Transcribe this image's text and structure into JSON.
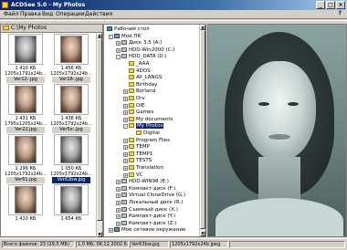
{
  "window": {
    "title": "ACDSee 5.0 - My Photos",
    "minimize": "_",
    "maximize": "□",
    "close": "×"
  },
  "menu": {
    "items": [
      "Файл",
      "Правка",
      "Вид",
      "Операции",
      "Действия"
    ],
    "help": "?"
  },
  "browser": {
    "path": "C:\\My Photos",
    "thumbnails": [
      {
        "size": "1 410 КБ",
        "dims": "1205x1792x24b...",
        "name": "Ver12-.jpg",
        "tone": "bw",
        "selected": false
      },
      {
        "size": "1 456 КБ",
        "dims": "1205x1792x24b...",
        "name": "Ver18-.jpg",
        "tone": "color",
        "selected": false
      },
      {
        "size": "1 431 КБ",
        "dims": "1795x1205x24b...",
        "name": "Ver22.jpg",
        "tone": "color",
        "selected": false
      },
      {
        "size": "1 438 КБ",
        "dims": "1205x1792x24b...",
        "name": "Ver5x-.jpg",
        "tone": "color",
        "selected": false
      },
      {
        "size": "1 299 КБ",
        "dims": "1205x1792x24b...",
        "name": "Ver61.jpg",
        "tone": "color",
        "selected": false
      },
      {
        "size": "1 050 КБ",
        "dims": "1205x1792x24b...",
        "name": "Ver63bw.jpg",
        "tone": "bw",
        "selected": true
      },
      {
        "size": "1 410 КБ",
        "dims": "",
        "name": "",
        "tone": "color",
        "selected": false
      },
      {
        "size": "1 654 КБ",
        "dims": "",
        "name": "",
        "tone": "bw",
        "selected": false
      }
    ]
  },
  "tree": {
    "items": [
      {
        "label": "Рабочий стол",
        "icon": "desktop-icon",
        "level": 0,
        "expander": "",
        "selected": false
      },
      {
        "label": "Мой ПК",
        "icon": "computer-icon",
        "level": 1,
        "expander": "-",
        "selected": false
      },
      {
        "label": "Диск 3,5 (A:)",
        "icon": "floppy-icon",
        "level": 2,
        "expander": "+",
        "selected": false
      },
      {
        "label": "HDD-Win2000 (C:)",
        "icon": "drive-icon",
        "level": 2,
        "expander": "+",
        "selected": false
      },
      {
        "label": "HDD_DATA (D:)",
        "icon": "drive-icon",
        "level": 2,
        "expander": "-",
        "selected": false
      },
      {
        "label": "_AAA",
        "icon": "folder-icon",
        "level": 3,
        "expander": "",
        "selected": false
      },
      {
        "label": "4DOS",
        "icon": "folder-icon",
        "level": 3,
        "expander": "",
        "selected": false
      },
      {
        "label": "All_LANGS",
        "icon": "folder-icon",
        "level": 3,
        "expander": "",
        "selected": false
      },
      {
        "label": "Birthday",
        "icon": "folder-icon",
        "level": 3,
        "expander": "",
        "selected": false
      },
      {
        "label": "Borland",
        "icon": "folder-icon",
        "level": 3,
        "expander": "+",
        "selected": false
      },
      {
        "label": "Drv",
        "icon": "folder-icon",
        "level": 3,
        "expander": "+",
        "selected": false
      },
      {
        "label": "DIE",
        "icon": "folder-icon",
        "level": 3,
        "expander": "+",
        "selected": false
      },
      {
        "label": "Games",
        "icon": "folder-icon",
        "level": 3,
        "expander": "+",
        "selected": false
      },
      {
        "label": "My documents",
        "icon": "folder-icon",
        "level": 3,
        "expander": "+",
        "selected": false
      },
      {
        "label": "My Photos",
        "icon": "folder-icon",
        "level": 3,
        "expander": "-",
        "selected": true
      },
      {
        "label": "Digital",
        "icon": "folder-icon",
        "level": 4,
        "expander": "",
        "selected": false
      },
      {
        "label": "Program Files",
        "icon": "folder-icon",
        "level": 3,
        "expander": "+",
        "selected": false
      },
      {
        "label": "TEMP",
        "icon": "folder-icon",
        "level": 3,
        "expander": "+",
        "selected": false
      },
      {
        "label": "TEMP1",
        "icon": "folder-icon",
        "level": 3,
        "expander": "+",
        "selected": false
      },
      {
        "label": "TESTS",
        "icon": "folder-icon",
        "level": 3,
        "expander": "+",
        "selected": false
      },
      {
        "label": "Translation",
        "icon": "folder-icon",
        "level": 3,
        "expander": "+",
        "selected": false
      },
      {
        "label": "VC",
        "icon": "folder-icon",
        "level": 3,
        "expander": "+",
        "selected": false
      },
      {
        "label": "HDD-WIN98 (E:)",
        "icon": "drive-icon",
        "level": 2,
        "expander": "+",
        "selected": false
      },
      {
        "label": "Компакт-диск (F:)",
        "icon": "cd-icon",
        "level": 2,
        "expander": "+",
        "selected": false
      },
      {
        "label": "Virtual CloneDrive (G:)",
        "icon": "cd-icon",
        "level": 2,
        "expander": "+",
        "selected": false
      },
      {
        "label": "Локальный диск (R:)",
        "icon": "drive-icon",
        "level": 2,
        "expander": "+",
        "selected": false
      },
      {
        "label": "Съемный диск (X:)",
        "icon": "drive-icon",
        "level": 2,
        "expander": "+",
        "selected": false
      },
      {
        "label": "Компакт-диск (Y:)",
        "icon": "cd-icon",
        "level": 2,
        "expander": "+",
        "selected": false
      },
      {
        "label": "Компакт-диск (Z:)",
        "icon": "cd-icon",
        "level": 2,
        "expander": "+",
        "selected": false
      },
      {
        "label": "Мое сетевое окружение",
        "icon": "network-icon",
        "level": 1,
        "expander": "+",
        "selected": false
      }
    ]
  },
  "status": {
    "total": "Всего файлов: 23 (29,5 МБ)",
    "filesize": "1,0 МБ, 06.12.2002 6:04",
    "filename": "Ver63bw.jpg",
    "dims": "1205x1792x24b jpeg"
  }
}
